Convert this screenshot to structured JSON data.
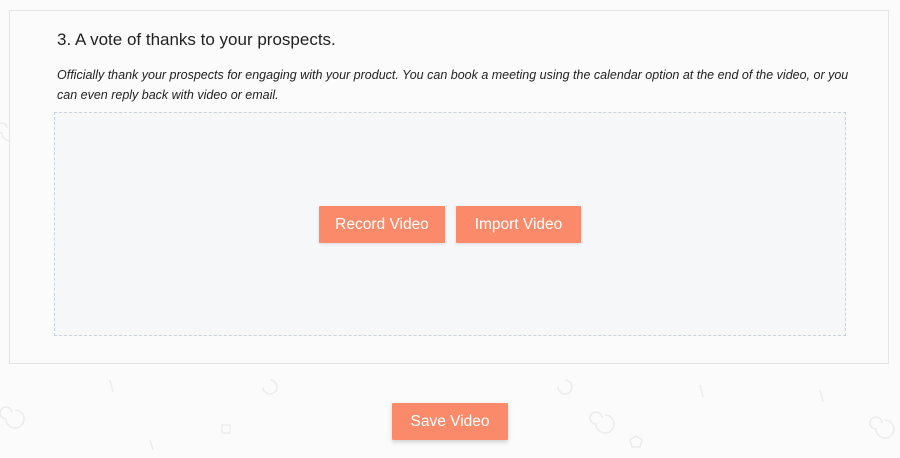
{
  "step": {
    "title": "3. A vote of thanks to your prospects.",
    "description": "Officially thank your prospects for engaging with your product. You can book a meeting using the calendar option at the end of the video, or you can even reply back with video or email."
  },
  "dropzone": {
    "record_label": "Record Video",
    "import_label": "Import Video"
  },
  "footer": {
    "save_label": "Save Video"
  },
  "colors": {
    "accent": "#fb8a6a",
    "dropzone_bg": "#f6f7f9",
    "dropzone_border": "#c9d3dd"
  }
}
